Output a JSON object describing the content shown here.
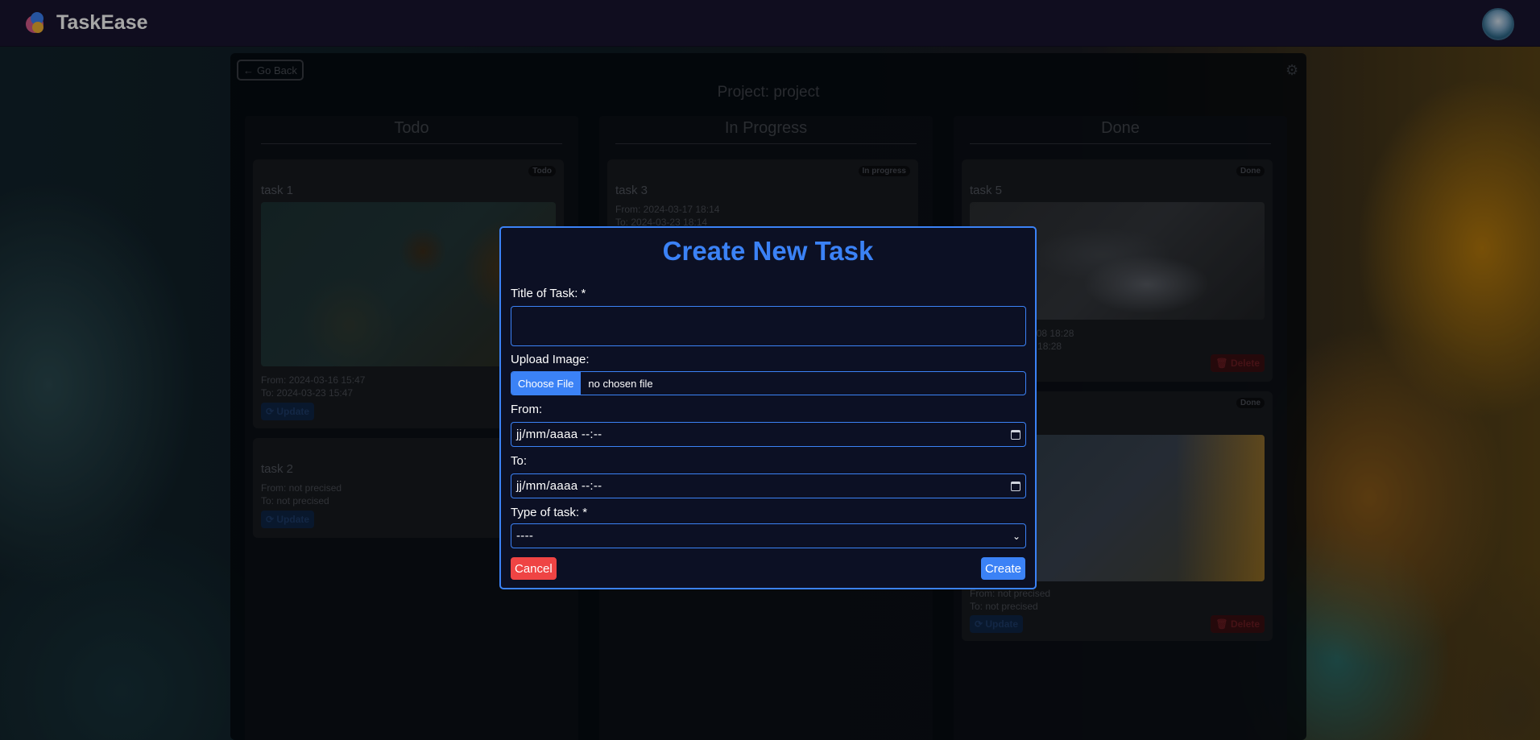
{
  "app": {
    "name": "TaskEase"
  },
  "board": {
    "go_back": "Go Back",
    "project_title": "Project: project",
    "columns": [
      {
        "title": "Todo"
      },
      {
        "title": "In Progress"
      },
      {
        "title": "Done"
      }
    ],
    "todo_cards": [
      {
        "badge": "Todo",
        "title": "task 1",
        "from": "From: 2024-03-16 15:47",
        "to": "To: 2024-03-23 15:47",
        "update": "Update"
      },
      {
        "title": "task 2",
        "from": "From: not precised",
        "to": "To: not precised",
        "update": "Update"
      }
    ],
    "progress_cards": [
      {
        "badge": "In progress",
        "title": "task 3",
        "from": "From: 2024-03-17 18:14",
        "to": "To: 2024-03-23 18:14"
      }
    ],
    "done_cards": [
      {
        "badge": "Done",
        "title": "task 5",
        "from": "From: 2024-03-08 18:28",
        "to": "To: 2024-03-14 18:28",
        "delete": "Delete"
      },
      {
        "badge": "Done",
        "from": "From: not precised",
        "to": "To: not precised",
        "update": "Update",
        "delete": "Delete"
      }
    ]
  },
  "modal": {
    "title": "Create New Task",
    "title_label": "Title of Task: *",
    "title_value": "",
    "upload_label": "Upload Image:",
    "choose_file": "Choose File",
    "no_file": "no chosen file",
    "from_label": "From:",
    "from_value": "jj/mm/aaaa --:--",
    "to_label": "To:",
    "to_value": "jj/mm/aaaa --:--",
    "type_label": "Type of task: *",
    "type_value": "----",
    "cancel": "Cancel",
    "create": "Create"
  },
  "colors": {
    "accent": "#3b82f6",
    "danger": "#ef4444",
    "modal_bg": "#0c1024",
    "navbar_bg": "#1a1530"
  },
  "icons": [
    "arrow-left-icon",
    "gear-icon",
    "refresh-icon",
    "trash-icon",
    "calendar-icon",
    "chevron-down-icon"
  ]
}
